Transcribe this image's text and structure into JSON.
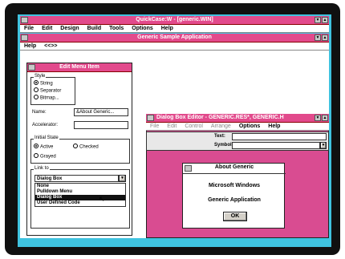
{
  "qc_window": {
    "title": "QuickCase:W - [generic.WIN]",
    "menu": [
      "File",
      "Edit",
      "Design",
      "Build",
      "Tools",
      "Options",
      "Help"
    ]
  },
  "generic_window": {
    "title": "Generic Sample Application",
    "menu": [
      "Help",
      "<<>>"
    ]
  },
  "edit_menu_item": {
    "title": "Edit Menu Item",
    "style_label": "Style",
    "style_options": [
      "String",
      "Separator",
      "Bitmap..."
    ],
    "name_label": "Name:",
    "name_value": "&About Generic...",
    "accelerator_label": "Accelerator:",
    "accelerator_value": "",
    "initial_state_label": "Initial State",
    "active_label": "Active",
    "checked_label": "Checked",
    "grayed_label": "Grayed",
    "link_label": "Link to",
    "link_value": "Dialog Box",
    "link_options": [
      "None",
      "Pulldown Menu",
      "Dialog Box",
      "User Defined Code"
    ]
  },
  "dialog_editor": {
    "title": "Dialog Box Editor - GENERIC.RES*, GENERIC.H",
    "menu": [
      "File",
      "Edit",
      "Control",
      "Arrange",
      "Options",
      "Help"
    ],
    "text_label": "Text:",
    "symbol_label": "Symbol:"
  },
  "about_dialog": {
    "title": "About Generic",
    "line1": "Microsoft Windows",
    "line2": "Generic Application",
    "ok_label": "OK"
  },
  "colors": {
    "desktop": "#3fc3e0",
    "title_bar": "#e24a8c",
    "dialog_background": "#d94c91",
    "bezel": "#101010"
  },
  "icons": [
    "system-menu-icon",
    "minimize-icon",
    "maximize-icon",
    "dropdown-arrow-icon",
    "mouse-pointer-icon"
  ]
}
